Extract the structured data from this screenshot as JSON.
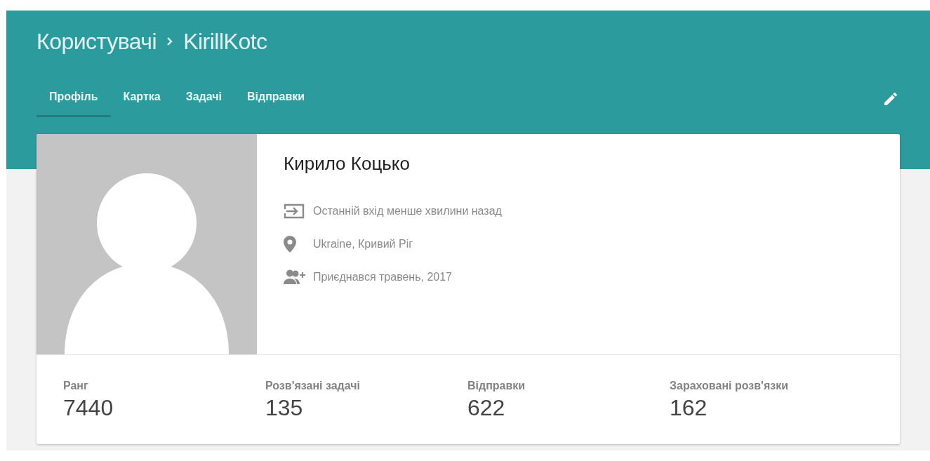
{
  "breadcrumb": [
    {
      "text": "Користувачі"
    },
    {
      "text": "KirillKotc"
    }
  ],
  "tabs": [
    {
      "label": "Профіль",
      "selected": true
    },
    {
      "label": "Картка",
      "selected": false
    },
    {
      "label": "Задачі",
      "selected": false
    },
    {
      "label": "Відправки",
      "selected": false
    }
  ],
  "profile": {
    "name": "Кирило Коцько",
    "info": [
      {
        "kind": "login",
        "text": "Останній вхід менше хвилини назад"
      },
      {
        "kind": "location",
        "text": "Ukraine, Кривий Ріг"
      },
      {
        "kind": "joined",
        "text": "Приєднався травень, 2017"
      }
    ]
  },
  "stats": [
    {
      "label": "Ранг",
      "value": "7440"
    },
    {
      "label": "Розв'язані задачі",
      "value": "135"
    },
    {
      "label": "Відправки",
      "value": "622"
    },
    {
      "label": "Зараховані розв'язки",
      "value": "162"
    }
  ]
}
